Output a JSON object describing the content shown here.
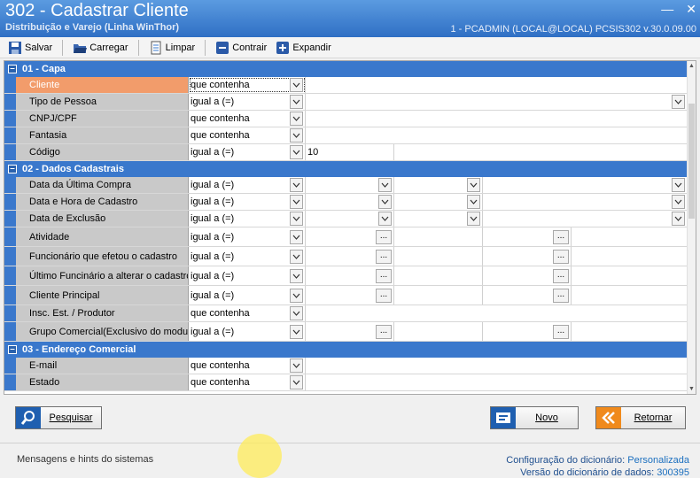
{
  "window": {
    "title": "302 - Cadastrar Cliente",
    "subtitle": "Distribuição e Varejo (Linha WinThor)",
    "info": "1 - PCADMIN (LOCAL@LOCAL)   PCSIS302  v.30.0.09.00",
    "minimize": "—",
    "close": "✕"
  },
  "toolbar": {
    "save": "Salvar",
    "load": "Carregar",
    "clear": "Limpar",
    "collapse": "Contrair",
    "expand": "Expandir"
  },
  "sections": [
    {
      "title": "01 - Capa",
      "rows": [
        {
          "label": "Cliente",
          "op": "que contenha",
          "selected": true
        },
        {
          "label": "Tipo de Pessoa",
          "op": "igual a (=)"
        },
        {
          "label": "CNPJ/CPF",
          "op": "que contenha"
        },
        {
          "label": "Fantasia",
          "op": "que contenha"
        },
        {
          "label": "Código",
          "op": "igual a (=)",
          "value": "10"
        }
      ]
    },
    {
      "title": "02 - Dados Cadastrais",
      "rows": [
        {
          "label": "Data da Última Compra",
          "op": "igual a (=)"
        },
        {
          "label": "Data e Hora de Cadastro",
          "op": "igual a (=)"
        },
        {
          "label": "Data de Exclusão",
          "op": "igual a (=)"
        },
        {
          "label": "Atividade",
          "op": "igual a (=)"
        },
        {
          "label": "Funcionário que efetou o cadastro",
          "op": "igual a (=)"
        },
        {
          "label": "Último Funcinário a alterar o cadastro",
          "op": "igual a (=)"
        },
        {
          "label": "Cliente Principal",
          "op": "igual a (=)"
        },
        {
          "label": "Insc. Est. / Produtor",
          "op": "que contenha"
        },
        {
          "label": "Grupo Comercial(Exclusivo do modulo",
          "op": "igual a (=)"
        }
      ]
    },
    {
      "title": "03 - Endereço Comercial",
      "rows": [
        {
          "label": "E-mail",
          "op": "que contenha"
        },
        {
          "label": "Estado",
          "op": "que contenha"
        }
      ]
    }
  ],
  "ellipsis": "...",
  "buttons": {
    "search": "Pesquisar",
    "new": "Novo",
    "back": "Retornar"
  },
  "status": {
    "message": "Mensagens e hints do sistemas",
    "config_label": "Configuração do dicionário:",
    "config_value": "Personalizada",
    "version_label": "Versão do dicionário de dados:",
    "version_value": "300395"
  },
  "colors": {
    "section_header": "#3a78cc",
    "label_bg": "#c9c9c9",
    "selected_label": "#f29c6b"
  }
}
